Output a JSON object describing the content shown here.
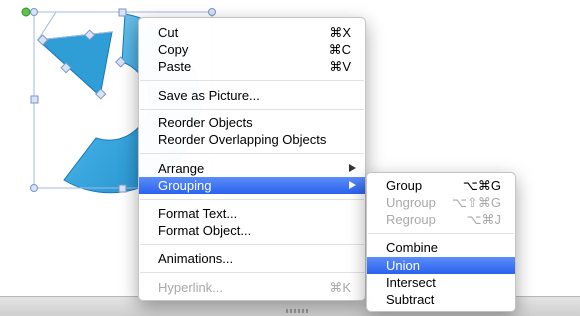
{
  "colors": {
    "shape_fill": "#2e9fd8",
    "shape_light": "#8dd0f0",
    "highlight": "#3a6ff2",
    "handle_green": "#5cc24a",
    "handle": "#c8d9f5"
  },
  "context_menu": {
    "items": [
      {
        "label": "Cut",
        "shortcut": "⌘X"
      },
      {
        "label": "Copy",
        "shortcut": "⌘C"
      },
      {
        "label": "Paste",
        "shortcut": "⌘V"
      },
      {
        "label": "Save as Picture...",
        "shortcut": ""
      },
      {
        "label": "Reorder Objects",
        "shortcut": ""
      },
      {
        "label": "Reorder Overlapping Objects",
        "shortcut": ""
      },
      {
        "label": "Arrange",
        "shortcut": ""
      },
      {
        "label": "Grouping",
        "shortcut": ""
      },
      {
        "label": "Format Text...",
        "shortcut": ""
      },
      {
        "label": "Format Object...",
        "shortcut": ""
      },
      {
        "label": "Animations...",
        "shortcut": ""
      },
      {
        "label": "Hyperlink...",
        "shortcut": "⌘K"
      }
    ]
  },
  "submenu": {
    "items": [
      {
        "label": "Group",
        "shortcut": "⌥⌘G"
      },
      {
        "label": "Ungroup",
        "shortcut": "⌥⇧⌘G"
      },
      {
        "label": "Regroup",
        "shortcut": "⌥⌘J"
      },
      {
        "label": "Combine",
        "shortcut": ""
      },
      {
        "label": "Union",
        "shortcut": ""
      },
      {
        "label": "Intersect",
        "shortcut": ""
      },
      {
        "label": "Subtract",
        "shortcut": ""
      }
    ]
  }
}
